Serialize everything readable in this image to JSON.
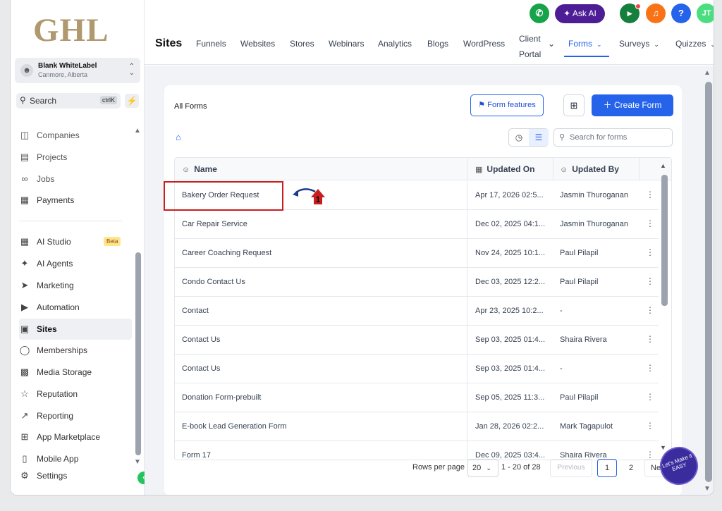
{
  "brand": {
    "logo_text": "GHL"
  },
  "account": {
    "name": "Blank WhiteLabel",
    "location": "Canmore, Alberta"
  },
  "sidebar": {
    "search_label": "Search",
    "search_shortcut": "ctrlK",
    "items": [
      {
        "label": "Companies",
        "icon": "building-icon"
      },
      {
        "label": "Projects",
        "icon": "folder-icon"
      },
      {
        "label": "Jobs",
        "icon": "link-icon"
      },
      {
        "label": "Payments",
        "icon": "receipt-icon"
      },
      {
        "label": "AI Studio",
        "icon": "ai-studio-icon",
        "badge": "Beta"
      },
      {
        "label": "AI Agents",
        "icon": "sparkle-icon"
      },
      {
        "label": "Marketing",
        "icon": "send-icon"
      },
      {
        "label": "Automation",
        "icon": "automation-icon"
      },
      {
        "label": "Sites",
        "icon": "sites-icon"
      },
      {
        "label": "Memberships",
        "icon": "award-icon"
      },
      {
        "label": "Media Storage",
        "icon": "image-icon"
      },
      {
        "label": "Reputation",
        "icon": "star-icon"
      },
      {
        "label": "Reporting",
        "icon": "trend-icon"
      },
      {
        "label": "App Marketplace",
        "icon": "grid-icon"
      },
      {
        "label": "Mobile App",
        "icon": "phone-icon"
      },
      {
        "label": "Settings",
        "icon": "gear-icon"
      }
    ]
  },
  "topbar": {
    "ask_ai": "Ask AI",
    "avatar_initials": "JT",
    "help": "?",
    "colors": {
      "phone": "#16a34a",
      "ask_ai": "#4c1d95",
      "megaphone": "#15803d",
      "bell": "#f97316",
      "help": "#2563eb",
      "avatar": "#4ade80"
    }
  },
  "header": {
    "title": "Sites",
    "tabs": [
      {
        "label": "Funnels"
      },
      {
        "label": "Websites"
      },
      {
        "label": "Stores"
      },
      {
        "label": "Webinars"
      },
      {
        "label": "Analytics"
      },
      {
        "label": "Blogs"
      },
      {
        "label": "WordPress"
      },
      {
        "label": "Client",
        "label2": "Portal"
      },
      {
        "label": "Forms"
      },
      {
        "label": "Surveys"
      },
      {
        "label": "Quizzes"
      }
    ]
  },
  "forms": {
    "title": "All Forms",
    "features_button": "Form features",
    "create_button": "Create Form",
    "search_placeholder": "Search for forms",
    "columns": {
      "name": "Name",
      "updated_on": "Updated On",
      "updated_by": "Updated By"
    },
    "rows": [
      {
        "name": "Bakery Order Request",
        "updated_on": "Apr 17, 2026 02:5...",
        "updated_by": "Jasmin Thuroganan"
      },
      {
        "name": "Car Repair Service",
        "updated_on": "Dec 02, 2025 04:1...",
        "updated_by": "Jasmin Thuroganan"
      },
      {
        "name": "Career Coaching Request",
        "updated_on": "Nov 24, 2025 10:1...",
        "updated_by": "Paul Pilapil"
      },
      {
        "name": "Condo Contact Us",
        "updated_on": "Dec 03, 2025 12:2...",
        "updated_by": "Paul Pilapil"
      },
      {
        "name": "Contact",
        "updated_on": "Apr 23, 2025 10:2...",
        "updated_by": "-"
      },
      {
        "name": "Contact Us",
        "updated_on": "Sep 03, 2025 01:4...",
        "updated_by": "Shaira Rivera"
      },
      {
        "name": "Contact Us",
        "updated_on": "Sep 03, 2025 01:4...",
        "updated_by": "-"
      },
      {
        "name": "Donation Form-prebuilt",
        "updated_on": "Sep 05, 2025 11:3...",
        "updated_by": "Paul Pilapil"
      },
      {
        "name": "E-book Lead Generation Form",
        "updated_on": "Jan 28, 2026 02:2...",
        "updated_by": "Mark Tagapulot"
      },
      {
        "name": "Form 17",
        "updated_on": "Dec 09, 2025 03:4...",
        "updated_by": "Shaira Rivera"
      }
    ],
    "pagination": {
      "rows_per_page_label": "Rows per page",
      "rows_per_page": "20",
      "range": "1 - 20 of 28",
      "previous": "Previous",
      "page1": "1",
      "page2": "2",
      "next": "Next"
    }
  },
  "annotation": {
    "step_number": "1",
    "color": "#c81e1e"
  },
  "watermark": {
    "text": "Let's Make it EASY"
  }
}
